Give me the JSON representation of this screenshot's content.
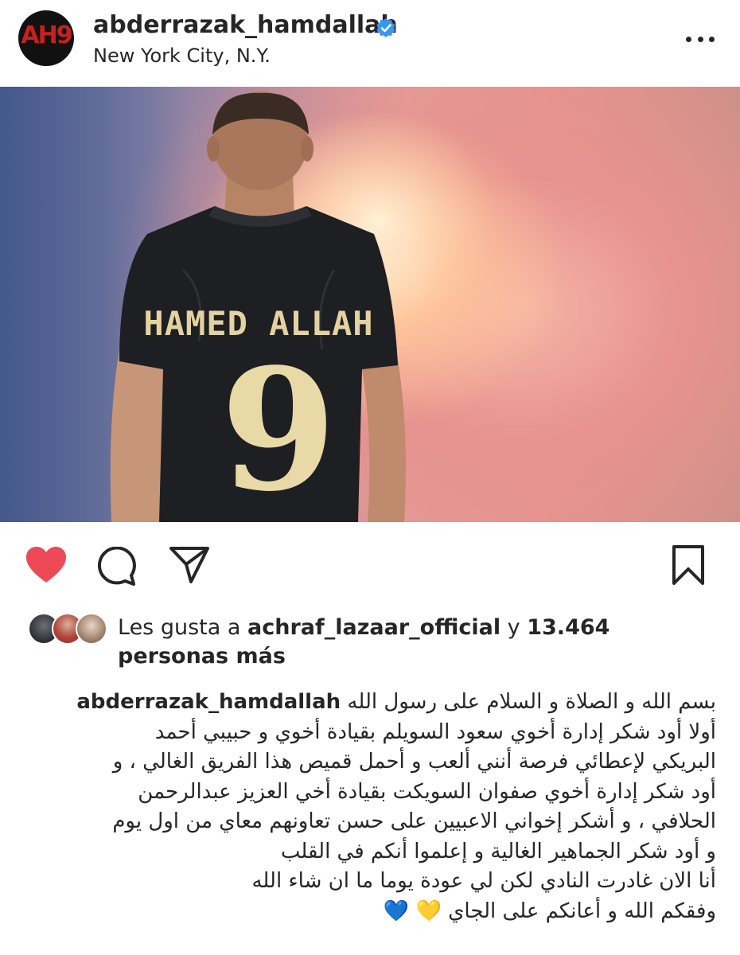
{
  "header": {
    "avatar_text": "AH9",
    "username": "abderrazak_hamdallah",
    "location": "New York City, N.Y."
  },
  "post": {
    "jersey_name": "HAMED ALLAH",
    "jersey_number": "9"
  },
  "likes": {
    "prefix": "Les gusta a ",
    "liker": "achraf_lazaar_official",
    "connector": " y ",
    "count": "13.464",
    "suffix": "personas más"
  },
  "caption": {
    "username": "abderrazak_hamdallah",
    "line1": "بسم الله و الصلاة و السلام على رسول الله",
    "line2": "أولا أود شكر إدارة أخوي سعود السويلم بقيادة أخوي و حبيبي أحمد",
    "line3": "البريكي لإعطائي فرصة أنني ألعب و أحمل قميص هذا الفريق الغالي ، و",
    "line4": "أود شكر إدارة أخوي صفوان السويكت بقيادة أخي العزيز عبدالرحمن",
    "line5": "الحلافي ، و أشكر إخواني الاعبيين على حسن تعاونهم معاي من اول يوم",
    "line6": "و أود شكر الجماهير الغالية و إعلموا أنكم في القلب",
    "line7": "أنا الان غادرت النادي لكن لي عودة يوما ما ان شاء الله",
    "line8": "وفقكم الله و أعانكم على الجاي",
    "emoji_yellow": "💛",
    "emoji_blue": "💙"
  },
  "colors": {
    "like_red": "#ed4956",
    "verified_blue": "#3897f0",
    "text": "#262626"
  },
  "icons": [
    "more-icon",
    "verified-badge-icon",
    "heart-icon",
    "comment-icon",
    "share-icon",
    "bookmark-icon"
  ]
}
